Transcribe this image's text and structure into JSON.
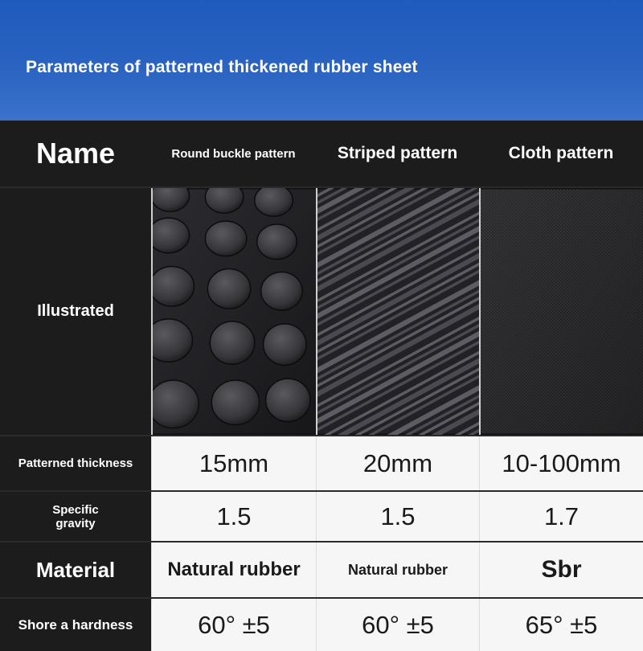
{
  "banner": {
    "title": "Parameters of patterned thickened rubber sheet"
  },
  "table": {
    "name_label": "Name",
    "columns": [
      "Round buckle pattern",
      "Striped pattern",
      "Cloth pattern"
    ],
    "rows": {
      "illustrated": {
        "label": "Illustrated"
      },
      "thickness": {
        "label": "Patterned thickness",
        "values": [
          "15mm",
          "20mm",
          "10-100mm"
        ]
      },
      "gravity": {
        "label_line1": "Specific",
        "label_line2": "gravity",
        "values": [
          "1.5",
          "1.5",
          "1.7"
        ]
      },
      "material": {
        "label": "Material",
        "values": [
          "Natural rubber",
          "Natural rubber",
          "Sbr"
        ]
      },
      "hardness": {
        "label": "Shore a hardness",
        "values": [
          "60° ±5",
          "60° ±5",
          "65° ±5"
        ]
      }
    }
  },
  "colors": {
    "banner": "#2a63c0",
    "label_bg": "#1c1c1c",
    "value_bg": "#f6f6f6"
  },
  "icons": [
    "round-buckle-texture",
    "striped-texture",
    "cloth-texture"
  ]
}
